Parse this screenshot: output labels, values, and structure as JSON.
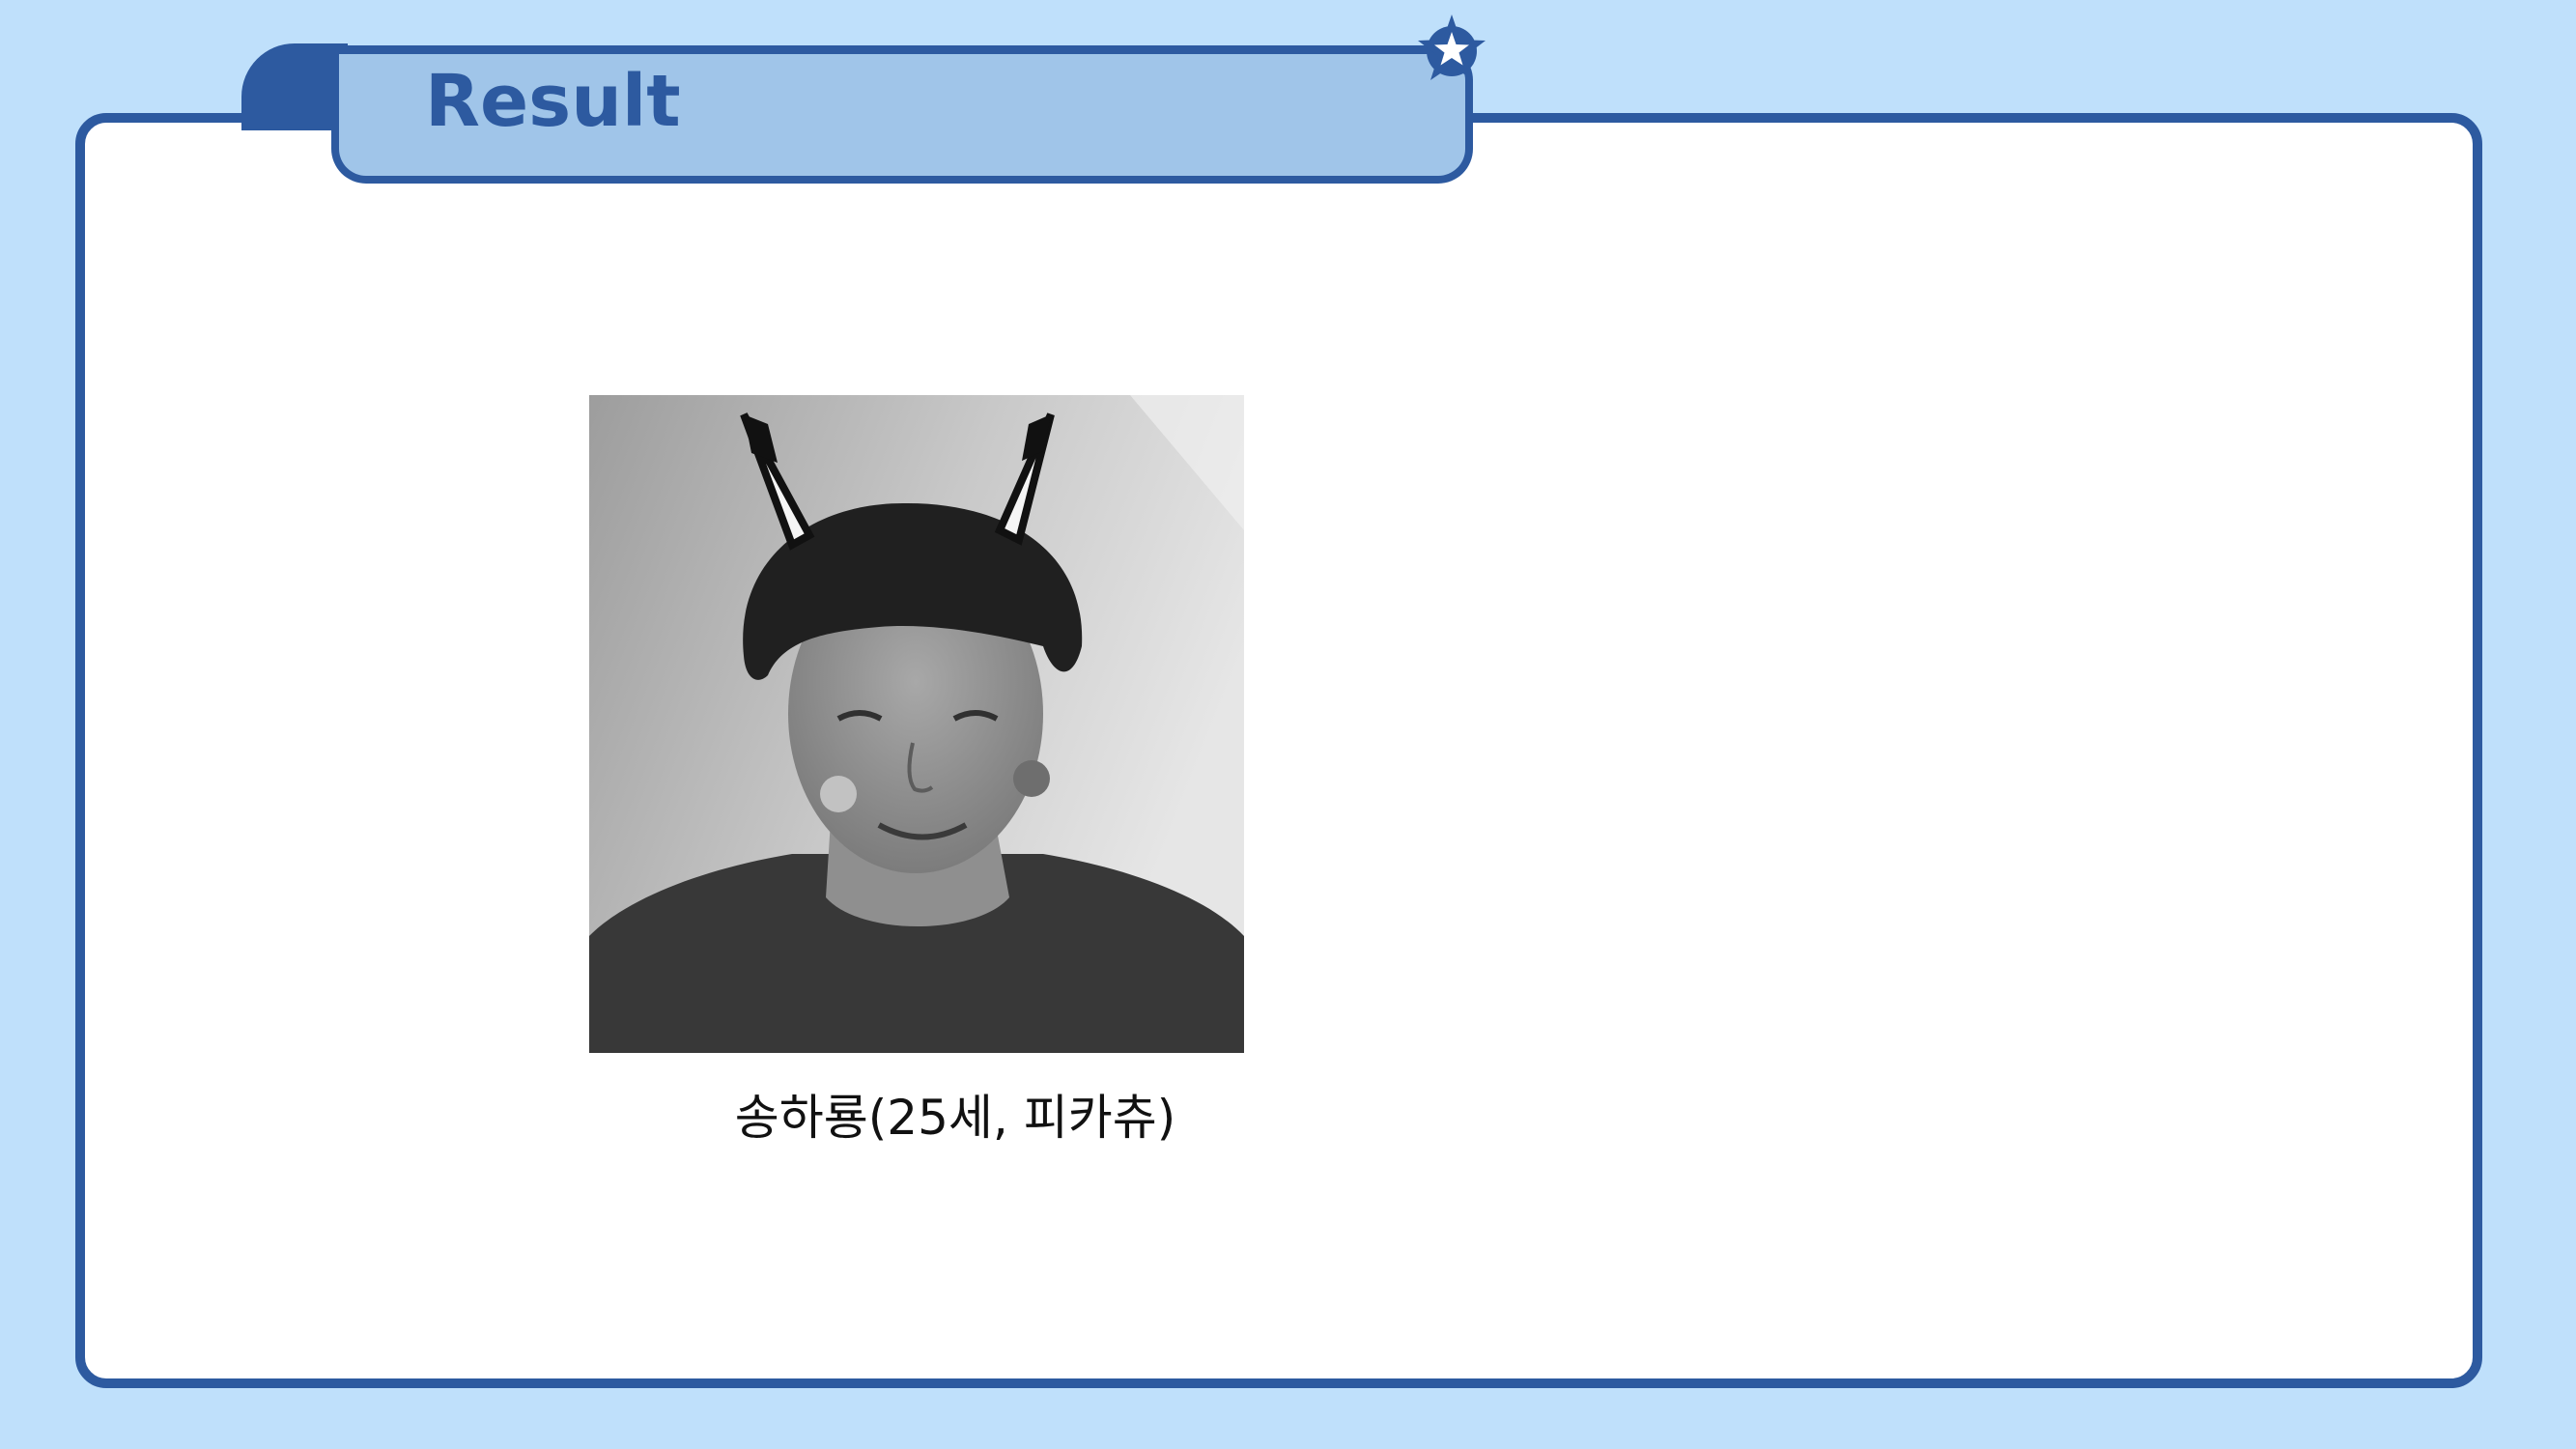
{
  "slide": {
    "title": "Result",
    "caption": "송하룡(25세, 피카츄)"
  },
  "icons": {
    "title_decoration": "star-icon"
  },
  "colors": {
    "background": "#bfe0fb",
    "border": "#2d5aa0",
    "title_tab_fill": "#a0c5e9",
    "card_fill": "#ffffff"
  }
}
